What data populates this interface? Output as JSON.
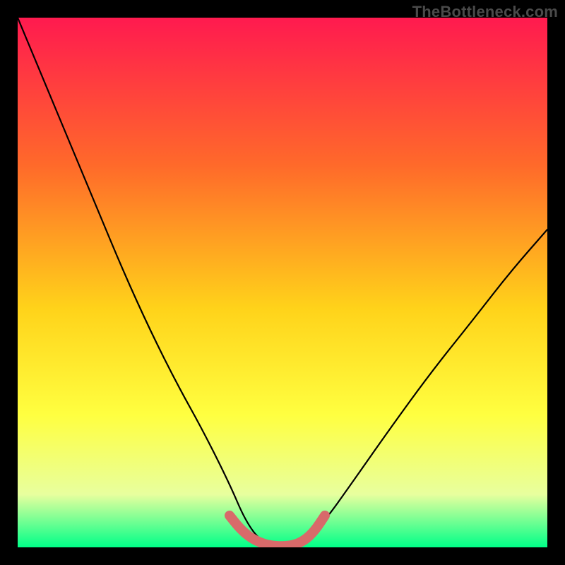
{
  "watermark": "TheBottleneck.com",
  "colors": {
    "frame": "#000000",
    "gradient_top": "#ff1a4f",
    "gradient_mid1": "#ff6a2a",
    "gradient_mid2": "#ffd31a",
    "gradient_mid3": "#ffff40",
    "gradient_mid4": "#e8ff9e",
    "gradient_bottom": "#00ff88",
    "curve": "#000000",
    "highlight": "#d86a6a"
  },
  "chart_data": {
    "type": "line",
    "title": "",
    "xlabel": "",
    "ylabel": "",
    "xlim": [
      0,
      100
    ],
    "ylim": [
      0,
      100
    ],
    "series": [
      {
        "name": "bottleneck-curve",
        "x": [
          0,
          5,
          10,
          15,
          20,
          25,
          30,
          35,
          40,
          43,
          46,
          50,
          54,
          58,
          63,
          70,
          78,
          86,
          93,
          100
        ],
        "values": [
          100,
          88,
          76,
          64,
          52,
          41,
          31,
          22,
          12,
          5,
          1,
          0,
          1,
          5,
          12,
          22,
          33,
          43,
          52,
          60
        ]
      },
      {
        "name": "trough-highlight",
        "x": [
          40,
          42,
          44,
          46,
          48,
          50,
          52,
          54,
          56,
          58
        ],
        "values": [
          6,
          3.5,
          1.8,
          0.8,
          0.3,
          0.2,
          0.4,
          1.2,
          3,
          6
        ]
      }
    ]
  }
}
